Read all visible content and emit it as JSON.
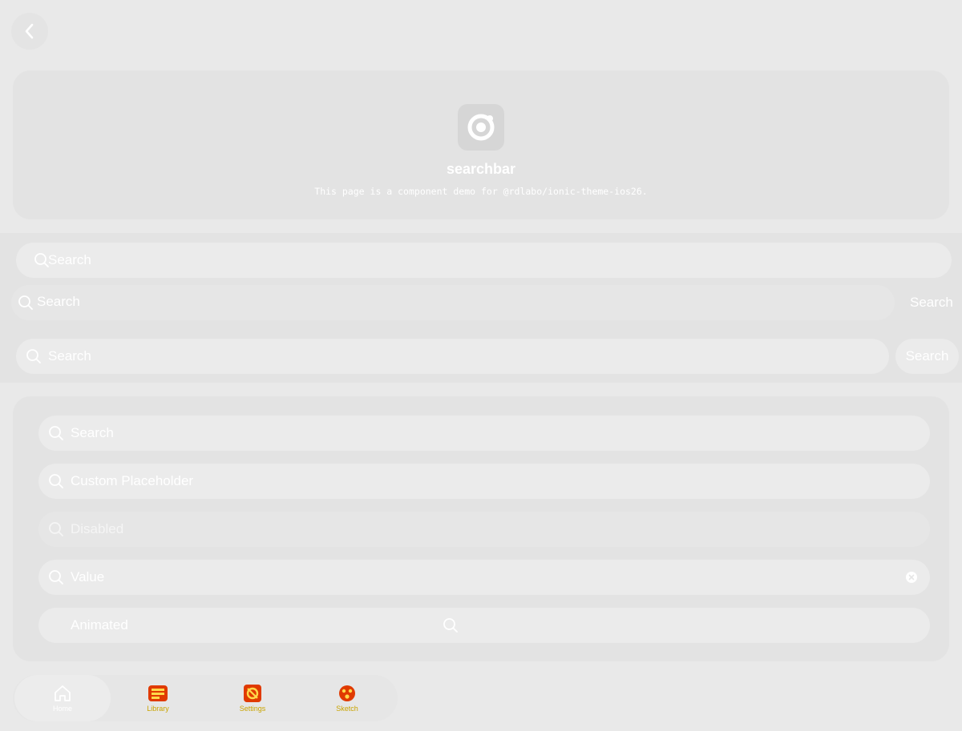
{
  "header": {
    "title": "searchbar",
    "description": "This page is a component demo for @rdlabo/ionic-theme-ios26."
  },
  "toolbar_searchbars": [
    {
      "placeholder": "Search"
    },
    {
      "placeholder": "Search",
      "cancel_label": "Search"
    },
    {
      "placeholder": "Search",
      "cancel_label": "Search"
    }
  ],
  "list_searchbars": [
    {
      "text": "Search",
      "state": "placeholder"
    },
    {
      "text": "Custom Placeholder",
      "state": "placeholder"
    },
    {
      "text": "Disabled",
      "state": "disabled"
    },
    {
      "text": "Value",
      "state": "value"
    },
    {
      "text": "Animated",
      "state": "placeholder"
    }
  ],
  "tabs": [
    {
      "label": "Home",
      "icon": "home-icon",
      "active": true
    },
    {
      "label": "Library",
      "icon": "library-icon",
      "active": false
    },
    {
      "label": "Settings",
      "icon": "settings-icon",
      "active": false
    },
    {
      "label": "Sketch",
      "icon": "sketch-icon",
      "active": false
    }
  ],
  "colors": {
    "background": "#e9e9e9",
    "card": "#e3e3e3",
    "field": "#ebebeb",
    "text": "#ffffff",
    "tab_inactive": "#c9a400"
  }
}
